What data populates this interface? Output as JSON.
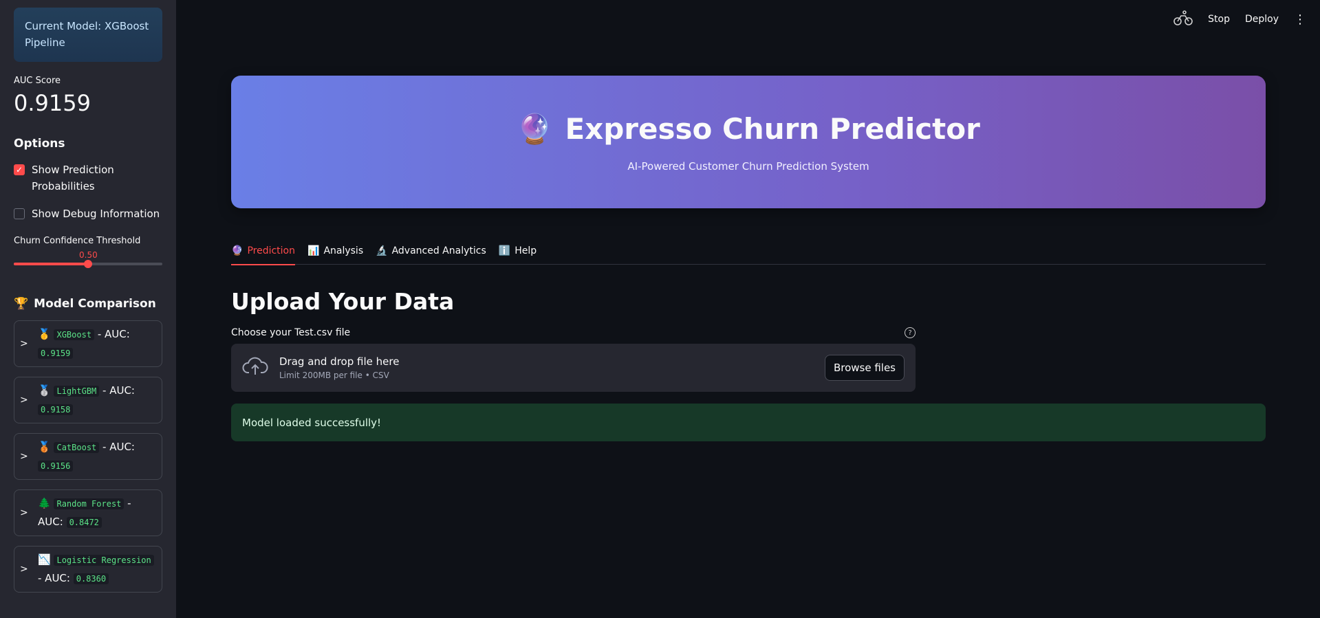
{
  "sidebar": {
    "model_box": "Current Model: XGBoost Pipeline",
    "auc_label": "AUC Score",
    "auc_value": "0.9159",
    "options_title": "Options",
    "show_probs_label": "Show Prediction Probabilities",
    "show_probs_checked": true,
    "show_debug_label": "Show Debug Information",
    "show_debug_checked": false,
    "threshold_label": "Churn Confidence Threshold",
    "threshold_value": "0.50",
    "threshold_fraction": 0.5,
    "comparison_title": "Model Comparison",
    "models": [
      {
        "icon": "🥇",
        "name": "XGBoost",
        "suffix": " - AUC:",
        "auc": "0.9159"
      },
      {
        "icon": "🥈",
        "name": "LightGBM",
        "suffix": " - AUC:",
        "auc": "0.9158"
      },
      {
        "icon": "🥉",
        "name": "CatBoost",
        "suffix": " - AUC:",
        "auc": "0.9156"
      },
      {
        "icon": "🌲",
        "name": "Random Forest",
        "suffix": " - AUC:",
        "auc": "0.8472"
      },
      {
        "icon": "📉",
        "name": "Logistic Regression",
        "suffix": " - AUC:",
        "auc": "0.8360"
      }
    ]
  },
  "topbar": {
    "stop_label": "Stop",
    "deploy_label": "Deploy"
  },
  "hero": {
    "title": "Expresso Churn Predictor",
    "subtitle": "AI-Powered Customer Churn Prediction System"
  },
  "tabs": [
    {
      "icon": "🔮",
      "label": "Prediction"
    },
    {
      "icon": "📊",
      "label": "Analysis"
    },
    {
      "icon": "🔬",
      "label": "Advanced Analytics"
    },
    {
      "icon": "ℹ️",
      "label": "Help"
    }
  ],
  "main": {
    "upload_title": "Upload Your Data",
    "choose_label": "Choose your Test.csv file",
    "drop_main": "Drag and drop file here",
    "drop_sub": "Limit 200MB per file • CSV",
    "browse_label": "Browse files",
    "success_message": "Model loaded successfully!"
  },
  "colors": {
    "accent": "#ff4b4b",
    "background": "#0e1117",
    "sidebar": "#262730",
    "success_bg": "#173928"
  }
}
